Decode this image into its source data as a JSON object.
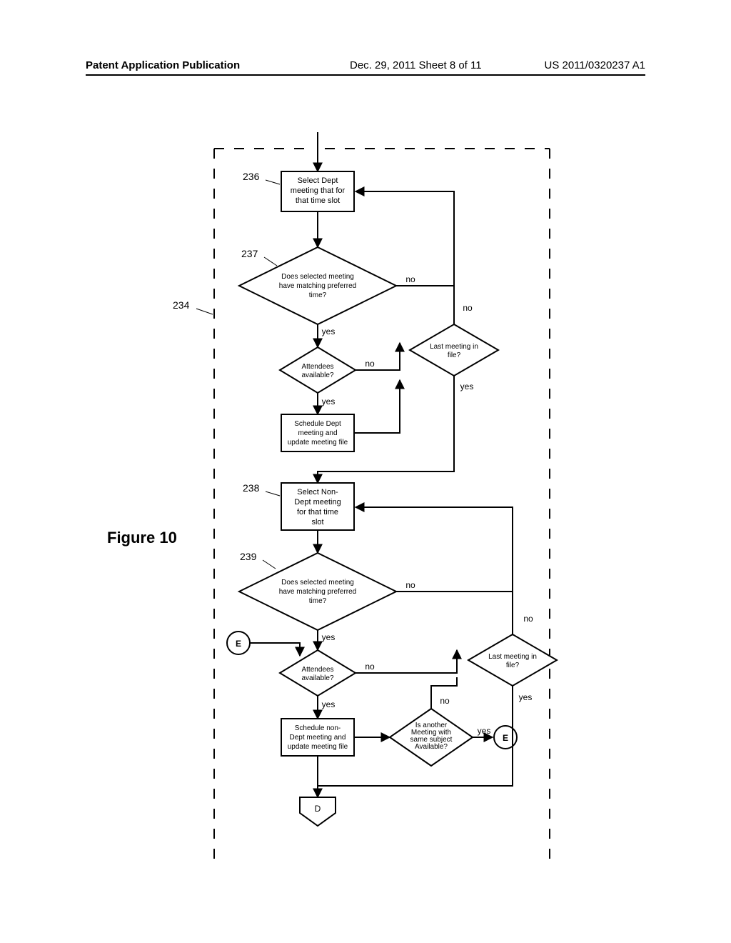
{
  "header": {
    "left": "Patent Application Publication",
    "mid": "Dec. 29, 2011  Sheet 8 of 11",
    "right": "US 2011/0320237 A1"
  },
  "figure_label": "Figure 10",
  "refs": {
    "r234": "234",
    "r236": "236",
    "r237": "237",
    "r238": "238",
    "r239": "239"
  },
  "boxes": {
    "b236_l1": "Select Dept",
    "b236_l2": "meeting that for",
    "b236_l3": "that time slot",
    "bsched1_l1": "Schedule Dept",
    "bsched1_l2": "meeting and",
    "bsched1_l3": "update meeting file",
    "b238_l1": "Select Non-",
    "b238_l2": "Dept meeting",
    "b238_l3": "for that time",
    "b238_l4": "slot",
    "bsched2_l1": "Schedule non-",
    "bsched2_l2": "Dept meeting and",
    "bsched2_l3": "update meeting file"
  },
  "diamonds": {
    "d237_l1": "Does selected meeting",
    "d237_l2": "have matching preferred",
    "d237_l3": "time?",
    "datt1_l1": "Attendees",
    "datt1_l2": "available?",
    "dlast1_l1": "Last meeting in",
    "dlast1_l2": "file?",
    "d239_l1": "Does selected meeting",
    "d239_l2": "have matching preferred",
    "d239_l3": "time?",
    "datt2_l1": "Attendees",
    "datt2_l2": "available?",
    "dlast2_l1": "Last meeting in",
    "dlast2_l2": "file?",
    "dsubj_l1": "Is another",
    "dsubj_l2": "Meeting with",
    "dsubj_l3": "same subject",
    "dsubj_l4": "Available?"
  },
  "labels": {
    "yes": "yes",
    "no": "no"
  },
  "connectors": {
    "D": "D",
    "E": "E"
  },
  "chart_data": {
    "type": "flowchart",
    "nodes": [
      {
        "id": "236",
        "type": "process",
        "text": "Select Dept meeting that for that time slot"
      },
      {
        "id": "237",
        "type": "decision",
        "text": "Does selected meeting have matching preferred time?"
      },
      {
        "id": "att1",
        "type": "decision",
        "text": "Attendees available?"
      },
      {
        "id": "sched1",
        "type": "process",
        "text": "Schedule Dept meeting and update meeting file"
      },
      {
        "id": "last1",
        "type": "decision",
        "text": "Last meeting in file?"
      },
      {
        "id": "238",
        "type": "process",
        "text": "Select Non-Dept meeting for that time slot"
      },
      {
        "id": "239",
        "type": "decision",
        "text": "Does selected meeting have matching preferred time?"
      },
      {
        "id": "att2",
        "type": "decision",
        "text": "Attendees available?"
      },
      {
        "id": "sched2",
        "type": "process",
        "text": "Schedule non-Dept meeting and update meeting file"
      },
      {
        "id": "subj",
        "type": "decision",
        "text": "Is another Meeting with same subject Available?"
      },
      {
        "id": "last2",
        "type": "decision",
        "text": "Last meeting in file?"
      },
      {
        "id": "E1",
        "type": "connector",
        "text": "E"
      },
      {
        "id": "E2",
        "type": "connector",
        "text": "E"
      },
      {
        "id": "D",
        "type": "offpage",
        "text": "D"
      }
    ],
    "edges": [
      {
        "from": "entry",
        "to": "236"
      },
      {
        "from": "236",
        "to": "237"
      },
      {
        "from": "237",
        "to": "att1",
        "label": "yes"
      },
      {
        "from": "237",
        "to": "last1",
        "label": "no"
      },
      {
        "from": "att1",
        "to": "sched1",
        "label": "yes"
      },
      {
        "from": "att1",
        "to": "last1",
        "label": "no"
      },
      {
        "from": "sched1",
        "to": "last1"
      },
      {
        "from": "last1",
        "to": "236",
        "label": "no"
      },
      {
        "from": "last1",
        "to": "238",
        "label": "yes"
      },
      {
        "from": "238",
        "to": "239"
      },
      {
        "from": "239",
        "to": "att2",
        "label": "yes"
      },
      {
        "from": "239",
        "to": "last2",
        "label": "no"
      },
      {
        "from": "att2",
        "to": "sched2",
        "label": "yes"
      },
      {
        "from": "att2",
        "to": "last2",
        "label": "no"
      },
      {
        "from": "sched2",
        "to": "subj"
      },
      {
        "from": "subj",
        "to": "E2",
        "label": "yes"
      },
      {
        "from": "subj",
        "to": "last2",
        "label": "no"
      },
      {
        "from": "last2",
        "to": "238",
        "label": "no"
      },
      {
        "from": "last2",
        "to": "D",
        "label": "yes"
      },
      {
        "from": "E1",
        "to": "att2"
      }
    ],
    "container_ref": "234"
  }
}
